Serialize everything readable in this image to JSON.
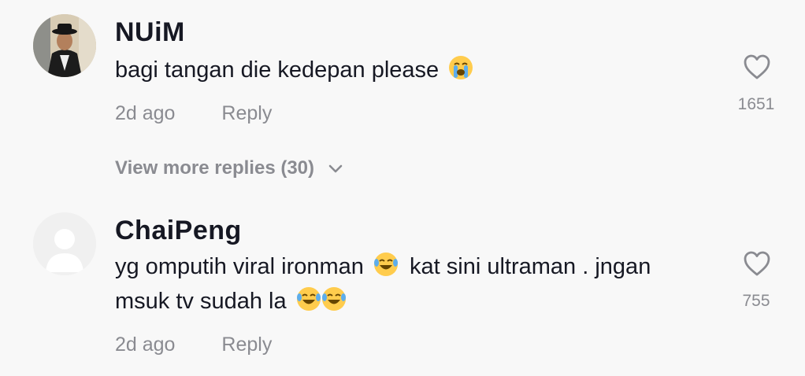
{
  "comments": [
    {
      "username": "NUiM",
      "text": "bagi tangan die kedepan please",
      "emoji": "loudly-crying-face",
      "time": "2d ago",
      "reply_label": "Reply",
      "likes": "1651"
    },
    {
      "username": "ChaiPeng",
      "text_line1": "yg omputih viral ironman",
      "text_line1b": "kat sini ultraman . jngan",
      "text_line2": "msuk tv sudah la",
      "emoji": "face-with-tears-of-joy",
      "time": "2d ago",
      "reply_label": "Reply",
      "likes": "755"
    }
  ],
  "view_more_replies": "View more replies (30)",
  "colors": {
    "background": "#f8f8f8",
    "text_primary": "#161823",
    "text_secondary": "#8a8b91"
  }
}
